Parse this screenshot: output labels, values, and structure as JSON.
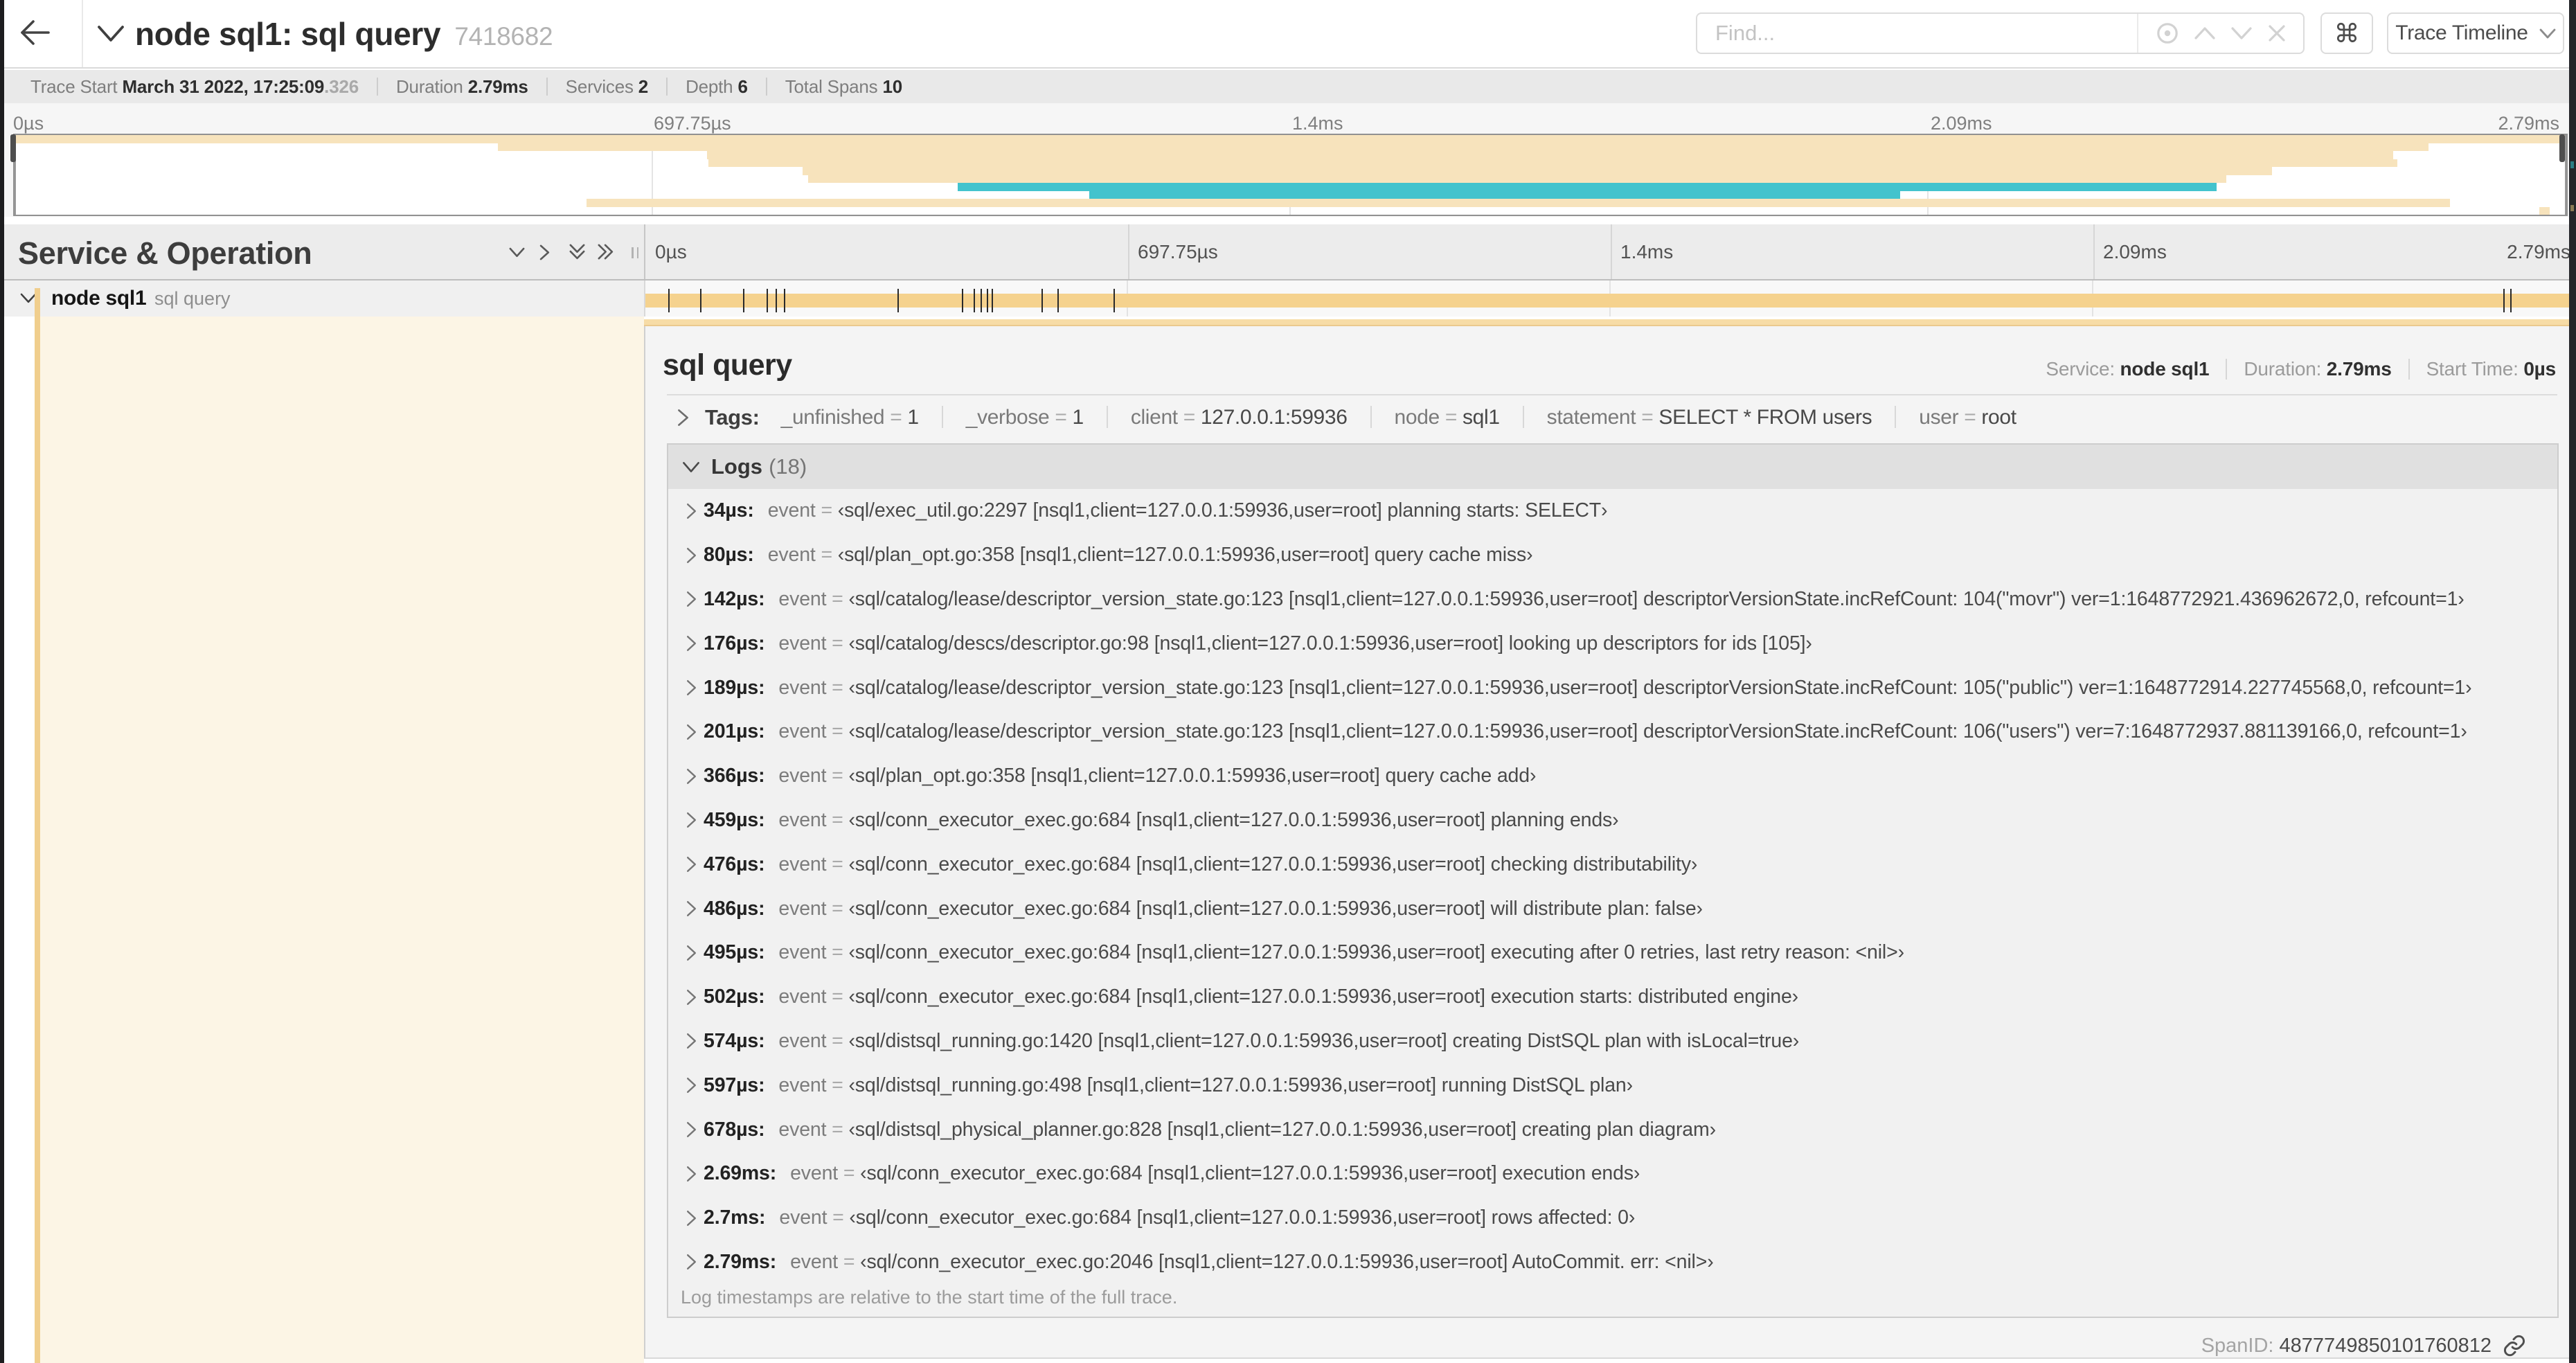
{
  "header": {
    "title": "node sql1: sql query",
    "trace_id_short": "7418682",
    "find_placeholder": "Find...",
    "keyboard_shortcut_glyph": "⌘",
    "view_selector_label": "Trace Timeline"
  },
  "trace_info": {
    "items": [
      {
        "label": "Trace Start ",
        "value": "March 31 2022, 17:25:09",
        "suffix": ".326"
      },
      {
        "label": "Duration ",
        "value": "2.79ms"
      },
      {
        "label": "Services ",
        "value": "2"
      },
      {
        "label": "Depth ",
        "value": "6"
      },
      {
        "label": "Total Spans ",
        "value": "10"
      }
    ]
  },
  "minimap": {
    "tick_labels": [
      "0µs",
      "697.75µs",
      "1.4ms",
      "2.09ms",
      "2.79ms"
    ],
    "spans": [
      {
        "start_pct": 0.0,
        "end_pct": 100.0,
        "color": "pale"
      },
      {
        "start_pct": 18.94,
        "end_pct": 94.59,
        "color": "pale"
      },
      {
        "start_pct": 27.15,
        "end_pct": 93.21,
        "color": "pale"
      },
      {
        "start_pct": 27.2,
        "end_pct": 93.37,
        "color": "pale"
      },
      {
        "start_pct": 30.87,
        "end_pct": 88.48,
        "color": "pale"
      },
      {
        "start_pct": 31.11,
        "end_pct": 86.68,
        "color": "pale"
      },
      {
        "start_pct": 36.96,
        "end_pct": 86.3,
        "color": "teal"
      },
      {
        "start_pct": 42.12,
        "end_pct": 73.89,
        "color": "teal"
      },
      {
        "start_pct": 22.42,
        "end_pct": 95.43,
        "color": "pale"
      },
      {
        "start_pct": 98.94,
        "end_pct": 99.35,
        "color": "pale"
      }
    ]
  },
  "timeline": {
    "column_header": "Service & Operation",
    "tick_labels": [
      "0µs",
      "697.75µs",
      "1.4ms",
      "2.09ms",
      "2.79ms"
    ],
    "duration_us": 2790,
    "row": {
      "service": "node sql1",
      "operation": "sql query"
    }
  },
  "detail": {
    "operation": "sql query",
    "summary": [
      {
        "label": "Service: ",
        "value": "node sql1"
      },
      {
        "label": "Duration: ",
        "value": "2.79ms"
      },
      {
        "label": "Start Time: ",
        "value": "0µs"
      }
    ],
    "tags_label": "Tags:",
    "tags": [
      {
        "key": "_unfinished",
        "value": "1"
      },
      {
        "key": "_verbose",
        "value": "1"
      },
      {
        "key": "client",
        "value": "127.0.0.1:59936"
      },
      {
        "key": "node",
        "value": "sql1"
      },
      {
        "key": "statement",
        "value": "SELECT * FROM users"
      },
      {
        "key": "user",
        "value": "root"
      }
    ],
    "logs_label": "Logs",
    "logs_count": "(18)",
    "logs": [
      {
        "t_us": 34,
        "time": "34µs:",
        "key": "event",
        "value": "‹sql/exec_util.go:2297 [nsql1,client=127.0.0.1:59936,user=root] planning starts: SELECT›"
      },
      {
        "t_us": 80,
        "time": "80µs:",
        "key": "event",
        "value": "‹sql/plan_opt.go:358 [nsql1,client=127.0.0.1:59936,user=root] query cache miss›"
      },
      {
        "t_us": 142,
        "time": "142µs:",
        "key": "event",
        "value": "‹sql/catalog/lease/descriptor_version_state.go:123 [nsql1,client=127.0.0.1:59936,user=root] descriptorVersionState.incRefCount: 104(\"movr\") ver=1:1648772921.436962672,0, refcount=1›"
      },
      {
        "t_us": 176,
        "time": "176µs:",
        "key": "event",
        "value": "‹sql/catalog/descs/descriptor.go:98 [nsql1,client=127.0.0.1:59936,user=root] looking up descriptors for ids [105]›"
      },
      {
        "t_us": 189,
        "time": "189µs:",
        "key": "event",
        "value": "‹sql/catalog/lease/descriptor_version_state.go:123 [nsql1,client=127.0.0.1:59936,user=root] descriptorVersionState.incRefCount: 105(\"public\") ver=1:1648772914.227745568,0, refcount=1›"
      },
      {
        "t_us": 201,
        "time": "201µs:",
        "key": "event",
        "value": "‹sql/catalog/lease/descriptor_version_state.go:123 [nsql1,client=127.0.0.1:59936,user=root] descriptorVersionState.incRefCount: 106(\"users\") ver=7:1648772937.881139166,0, refcount=1›"
      },
      {
        "t_us": 366,
        "time": "366µs:",
        "key": "event",
        "value": "‹sql/plan_opt.go:358 [nsql1,client=127.0.0.1:59936,user=root] query cache add›"
      },
      {
        "t_us": 459,
        "time": "459µs:",
        "key": "event",
        "value": "‹sql/conn_executor_exec.go:684 [nsql1,client=127.0.0.1:59936,user=root] planning ends›"
      },
      {
        "t_us": 476,
        "time": "476µs:",
        "key": "event",
        "value": "‹sql/conn_executor_exec.go:684 [nsql1,client=127.0.0.1:59936,user=root] checking distributability›"
      },
      {
        "t_us": 486,
        "time": "486µs:",
        "key": "event",
        "value": "‹sql/conn_executor_exec.go:684 [nsql1,client=127.0.0.1:59936,user=root] will distribute plan: false›"
      },
      {
        "t_us": 495,
        "time": "495µs:",
        "key": "event",
        "value": "‹sql/conn_executor_exec.go:684 [nsql1,client=127.0.0.1:59936,user=root] executing after 0 retries, last retry reason: <nil>›"
      },
      {
        "t_us": 502,
        "time": "502µs:",
        "key": "event",
        "value": "‹sql/conn_executor_exec.go:684 [nsql1,client=127.0.0.1:59936,user=root] execution starts: distributed engine›"
      },
      {
        "t_us": 574,
        "time": "574µs:",
        "key": "event",
        "value": "‹sql/distsql_running.go:1420 [nsql1,client=127.0.0.1:59936,user=root] creating DistSQL plan with isLocal=true›"
      },
      {
        "t_us": 597,
        "time": "597µs:",
        "key": "event",
        "value": "‹sql/distsql_running.go:498 [nsql1,client=127.0.0.1:59936,user=root] running DistSQL plan›"
      },
      {
        "t_us": 678,
        "time": "678µs:",
        "key": "event",
        "value": "‹sql/distsql_physical_planner.go:828 [nsql1,client=127.0.0.1:59936,user=root] creating plan diagram›"
      },
      {
        "t_us": 2690,
        "time": "2.69ms:",
        "key": "event",
        "value": "‹sql/conn_executor_exec.go:684 [nsql1,client=127.0.0.1:59936,user=root] execution ends›"
      },
      {
        "t_us": 2700,
        "time": "2.7ms:",
        "key": "event",
        "value": "‹sql/conn_executor_exec.go:684 [nsql1,client=127.0.0.1:59936,user=root] rows affected: 0›"
      },
      {
        "t_us": 2790,
        "time": "2.79ms:",
        "key": "event",
        "value": "‹sql/conn_executor_exec.go:2046 [nsql1,client=127.0.0.1:59936,user=root] AutoCommit. err: <nil>›"
      }
    ],
    "logs_footer": "Log timestamps are relative to the start time of the full trace.",
    "span_id_label": "SpanID: ",
    "span_id": "4877749850101760812"
  },
  "colors": {
    "span": "#F5D28E",
    "pale": "#F7E3BC",
    "teal": "#43C3CD",
    "accent": "#F7DCA6",
    "accent_edge": "#EBC98D",
    "strip": "#F0CE8D",
    "cream": "#FCF5E5"
  }
}
